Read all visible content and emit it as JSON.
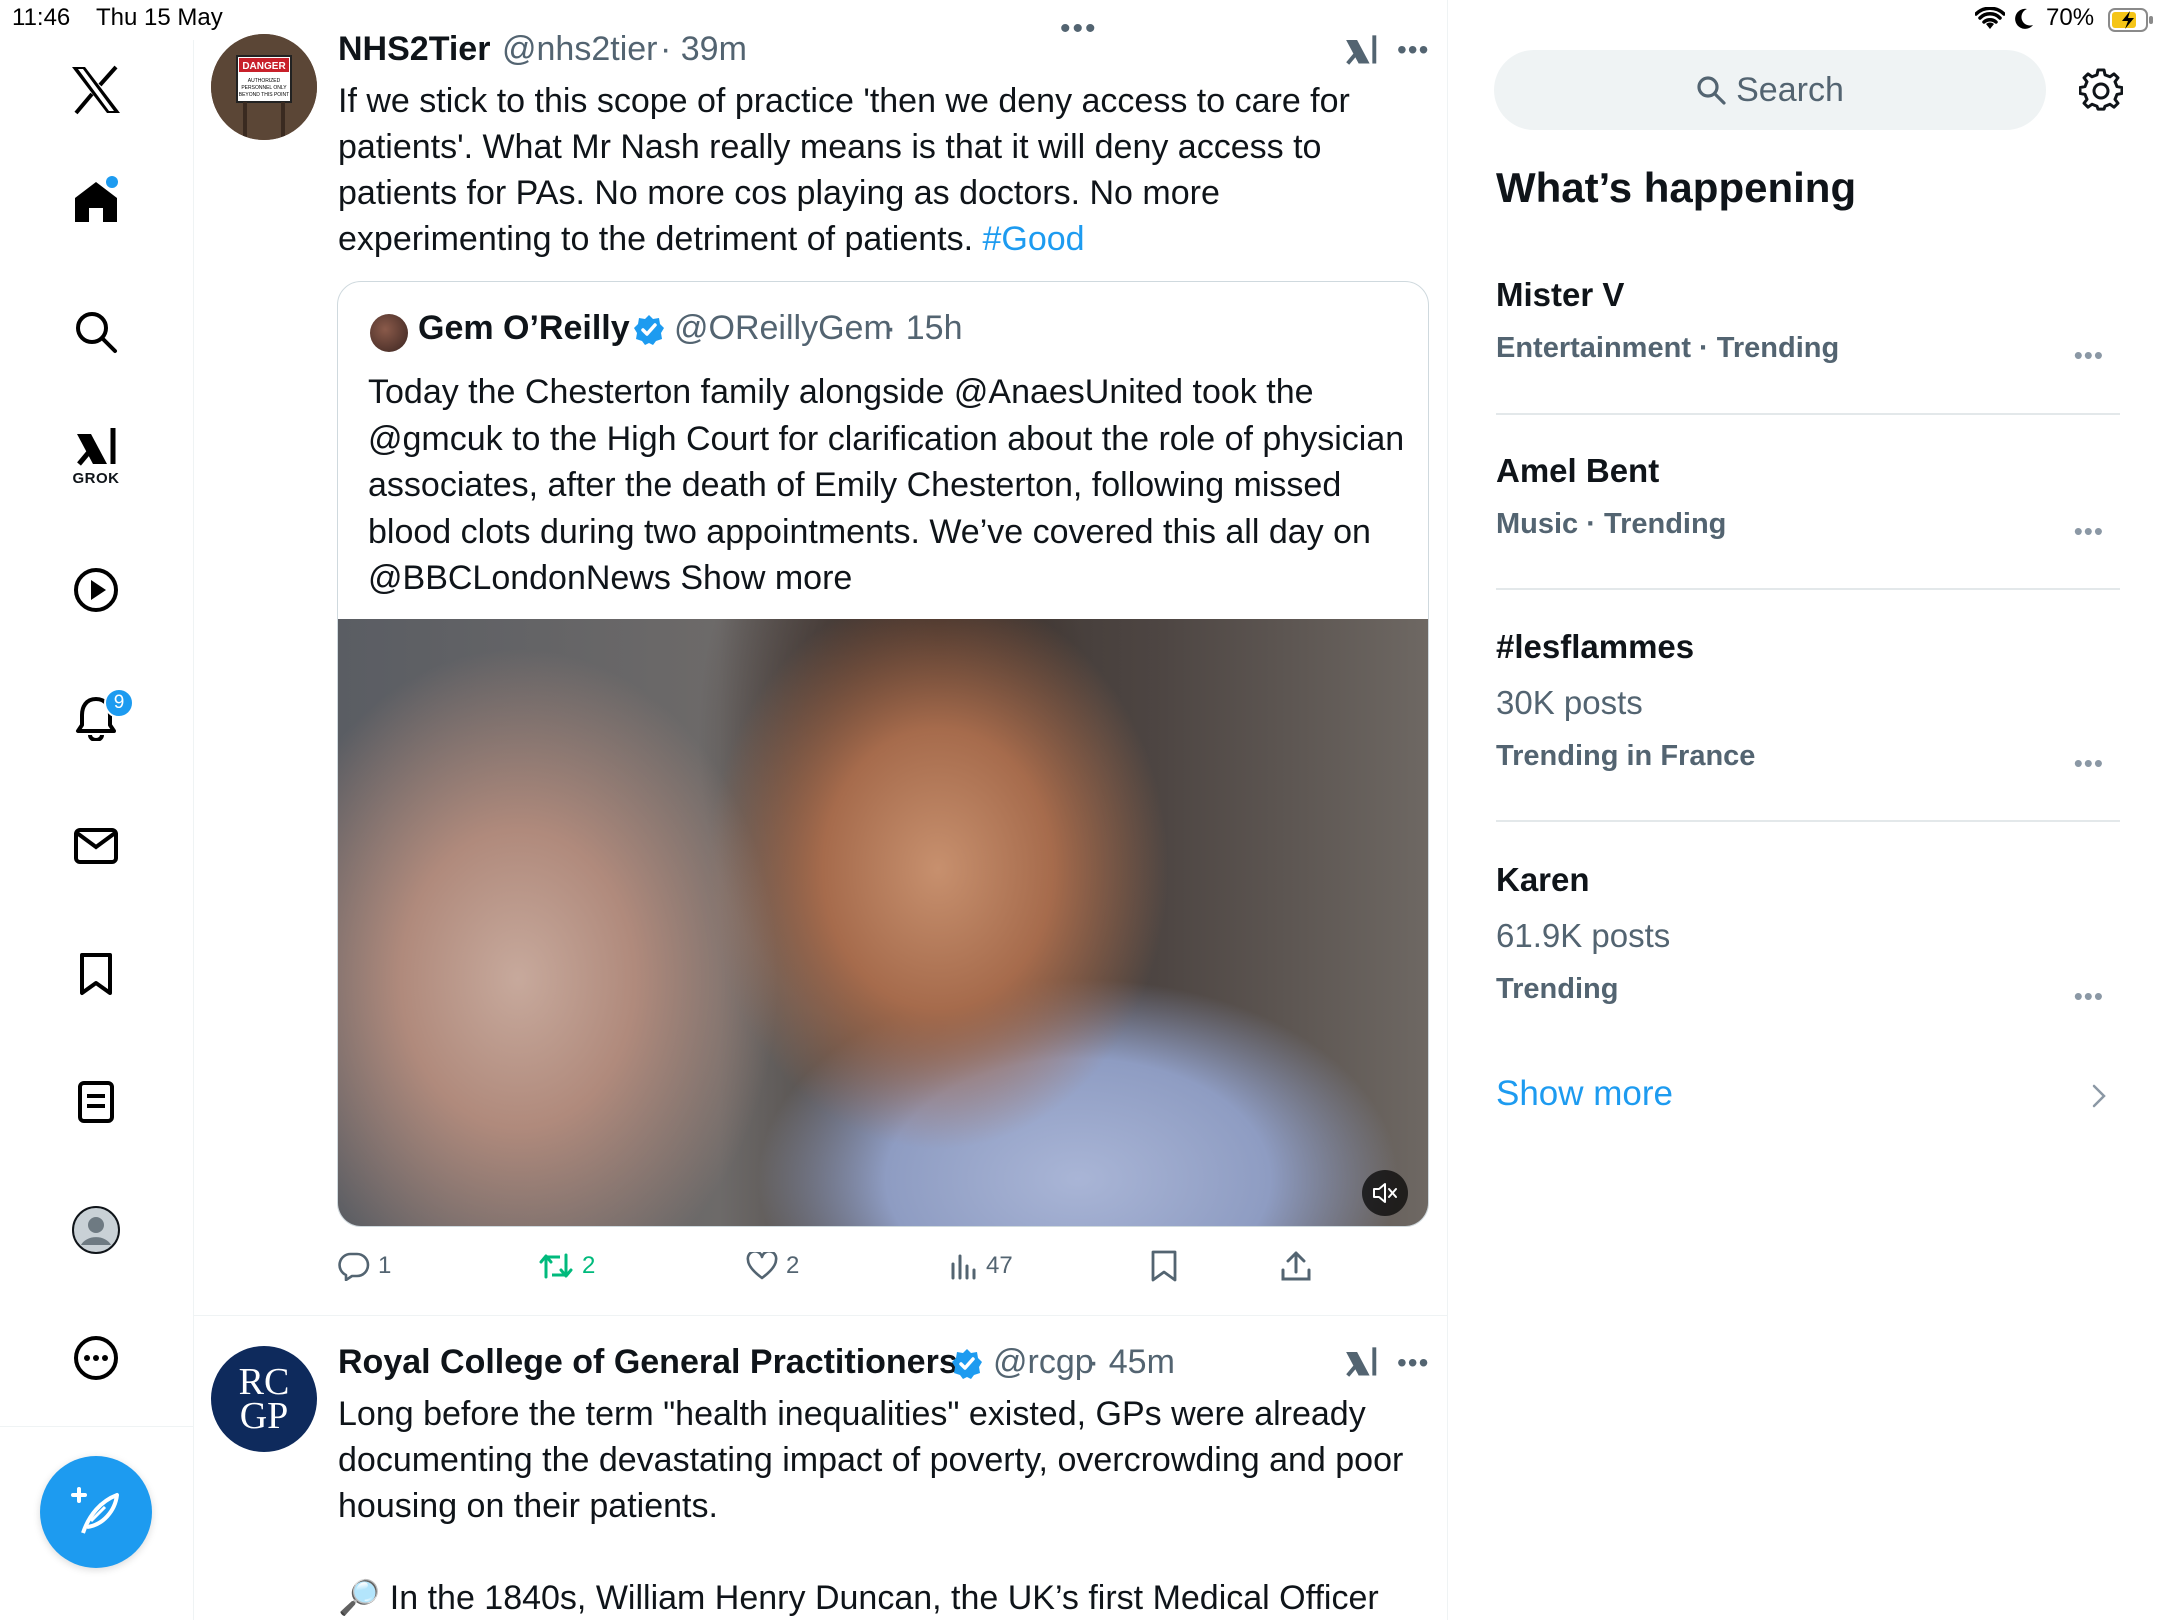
{
  "status_bar": {
    "time": "11:46",
    "date": "Thu 15 May",
    "battery": "70%"
  },
  "nav": {
    "grok_label": "GROK",
    "notifications_count": "9"
  },
  "tweets": [
    {
      "name": "NHS2Tier",
      "handle": "@nhs2tier",
      "time": "· 39m",
      "text": "If we stick to this scope of practice 'then we deny access to care for patients'. What Mr Nash really means is that it will deny access to patients for PAs. No more cos playing as doctors. No more experimenting to the detriment of patients. ",
      "hashtag": "#Good",
      "quote": {
        "name": "Gem O’Reilly",
        "handle": "@OReillyGem",
        "time": "· 15h",
        "text": "Today the Chesterton family alongside @AnaesUnited took the @gmcuk to the High Court for clarification about the role of physician associates, after the death of Emily Chesterton, following missed blood clots during two appointments. We’ve covered this all day on @BBCLondonNews Show more"
      },
      "actions": {
        "replies": "1",
        "reposts": "2",
        "likes": "2",
        "views": "47"
      },
      "avatar_sign": {
        "danger": "DANGER",
        "line1": "AUTHORIZED",
        "line2": "PERSONNEL ONLY",
        "line3": "BEYOND THIS POINT"
      }
    },
    {
      "name": "Royal College of General Practitioners",
      "handle": "@rcgp",
      "time": "· 45m",
      "text_lines": [
        "Long before the term \"health inequalities\" existed, GPs were already documenting the devastating impact of poverty, overcrowding and poor housing on their patients.",
        "🔎 In the 1840s, William Henry Duncan, the UK’s first Medical Officer"
      ],
      "avatar_text": [
        "RC",
        "GP"
      ]
    }
  ],
  "sidebar": {
    "search_placeholder": "Search",
    "heading": "What’s happening",
    "trends": [
      {
        "title": "Mister V",
        "meta": "Entertainment · Trending",
        "posts": ""
      },
      {
        "title": "Amel Bent",
        "meta": "Music · Trending",
        "posts": ""
      },
      {
        "title": "#lesflammes",
        "meta": "Trending in France",
        "posts": "30K posts"
      },
      {
        "title": "Karen",
        "meta": "Trending",
        "posts": "61.9K posts"
      }
    ],
    "show_more": "Show more"
  },
  "colors": {
    "accent": "#1d9bf0",
    "repost_active": "#00ba7c",
    "secondary_text": "#536471"
  }
}
